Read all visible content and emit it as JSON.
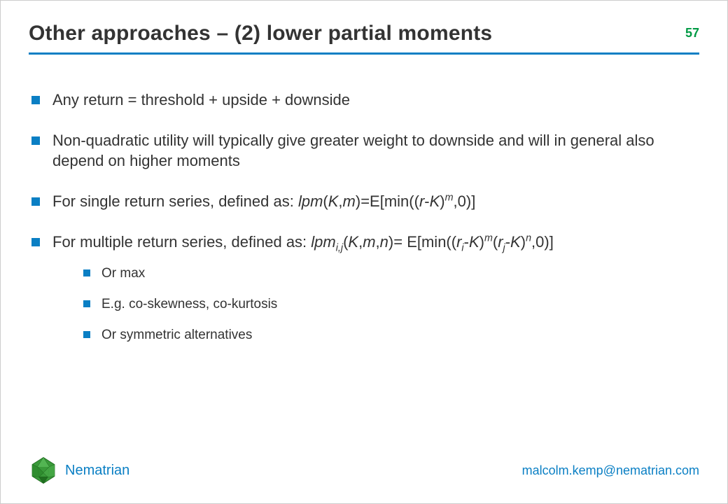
{
  "header": {
    "title": "Other approaches – (2) lower partial moments",
    "page_number": "57"
  },
  "bullets": {
    "b1": "Any return = threshold + upside + downside",
    "b2": "Non-quadratic utility will typically give greater weight to downside and will in general also depend on higher moments",
    "b3_prefix": "For single return series, defined as: ",
    "b3_formula": {
      "lpm": "lpm",
      "open": "(",
      "K": "K",
      "comma1": ",",
      "m": "m",
      "close": ")=E[min((",
      "r": "r",
      "minus": "-",
      "K2": "K",
      "rparen": ")",
      "sup_m": "m",
      "tail": ",0)]"
    },
    "b4_prefix": "For multiple return series, defined as: ",
    "b4_formula": {
      "lpm": "lpm",
      "sub_ij": "i,j",
      "open": "(",
      "K": "K",
      "comma1": ",",
      "m": "m",
      "comma2": ",",
      "n": "n",
      "close": ")= E[min((",
      "r1": "r",
      "sub_i": "i",
      "minus1": "-",
      "K2": "K",
      "rparen1": ")",
      "sup_m": "m",
      "open2": "(",
      "r2": "r",
      "sub_j": "j",
      "minus2": "-",
      "K3": "K",
      "rparen2": ")",
      "sup_n": "n",
      "tail": ",0)]"
    },
    "sub": {
      "s1": "Or max",
      "s2": "E.g. co-skewness, co-kurtosis",
      "s3": "Or symmetric alternatives"
    }
  },
  "footer": {
    "brand": "Nematrian",
    "contact": "malcolm.kemp@nematrian.com"
  }
}
